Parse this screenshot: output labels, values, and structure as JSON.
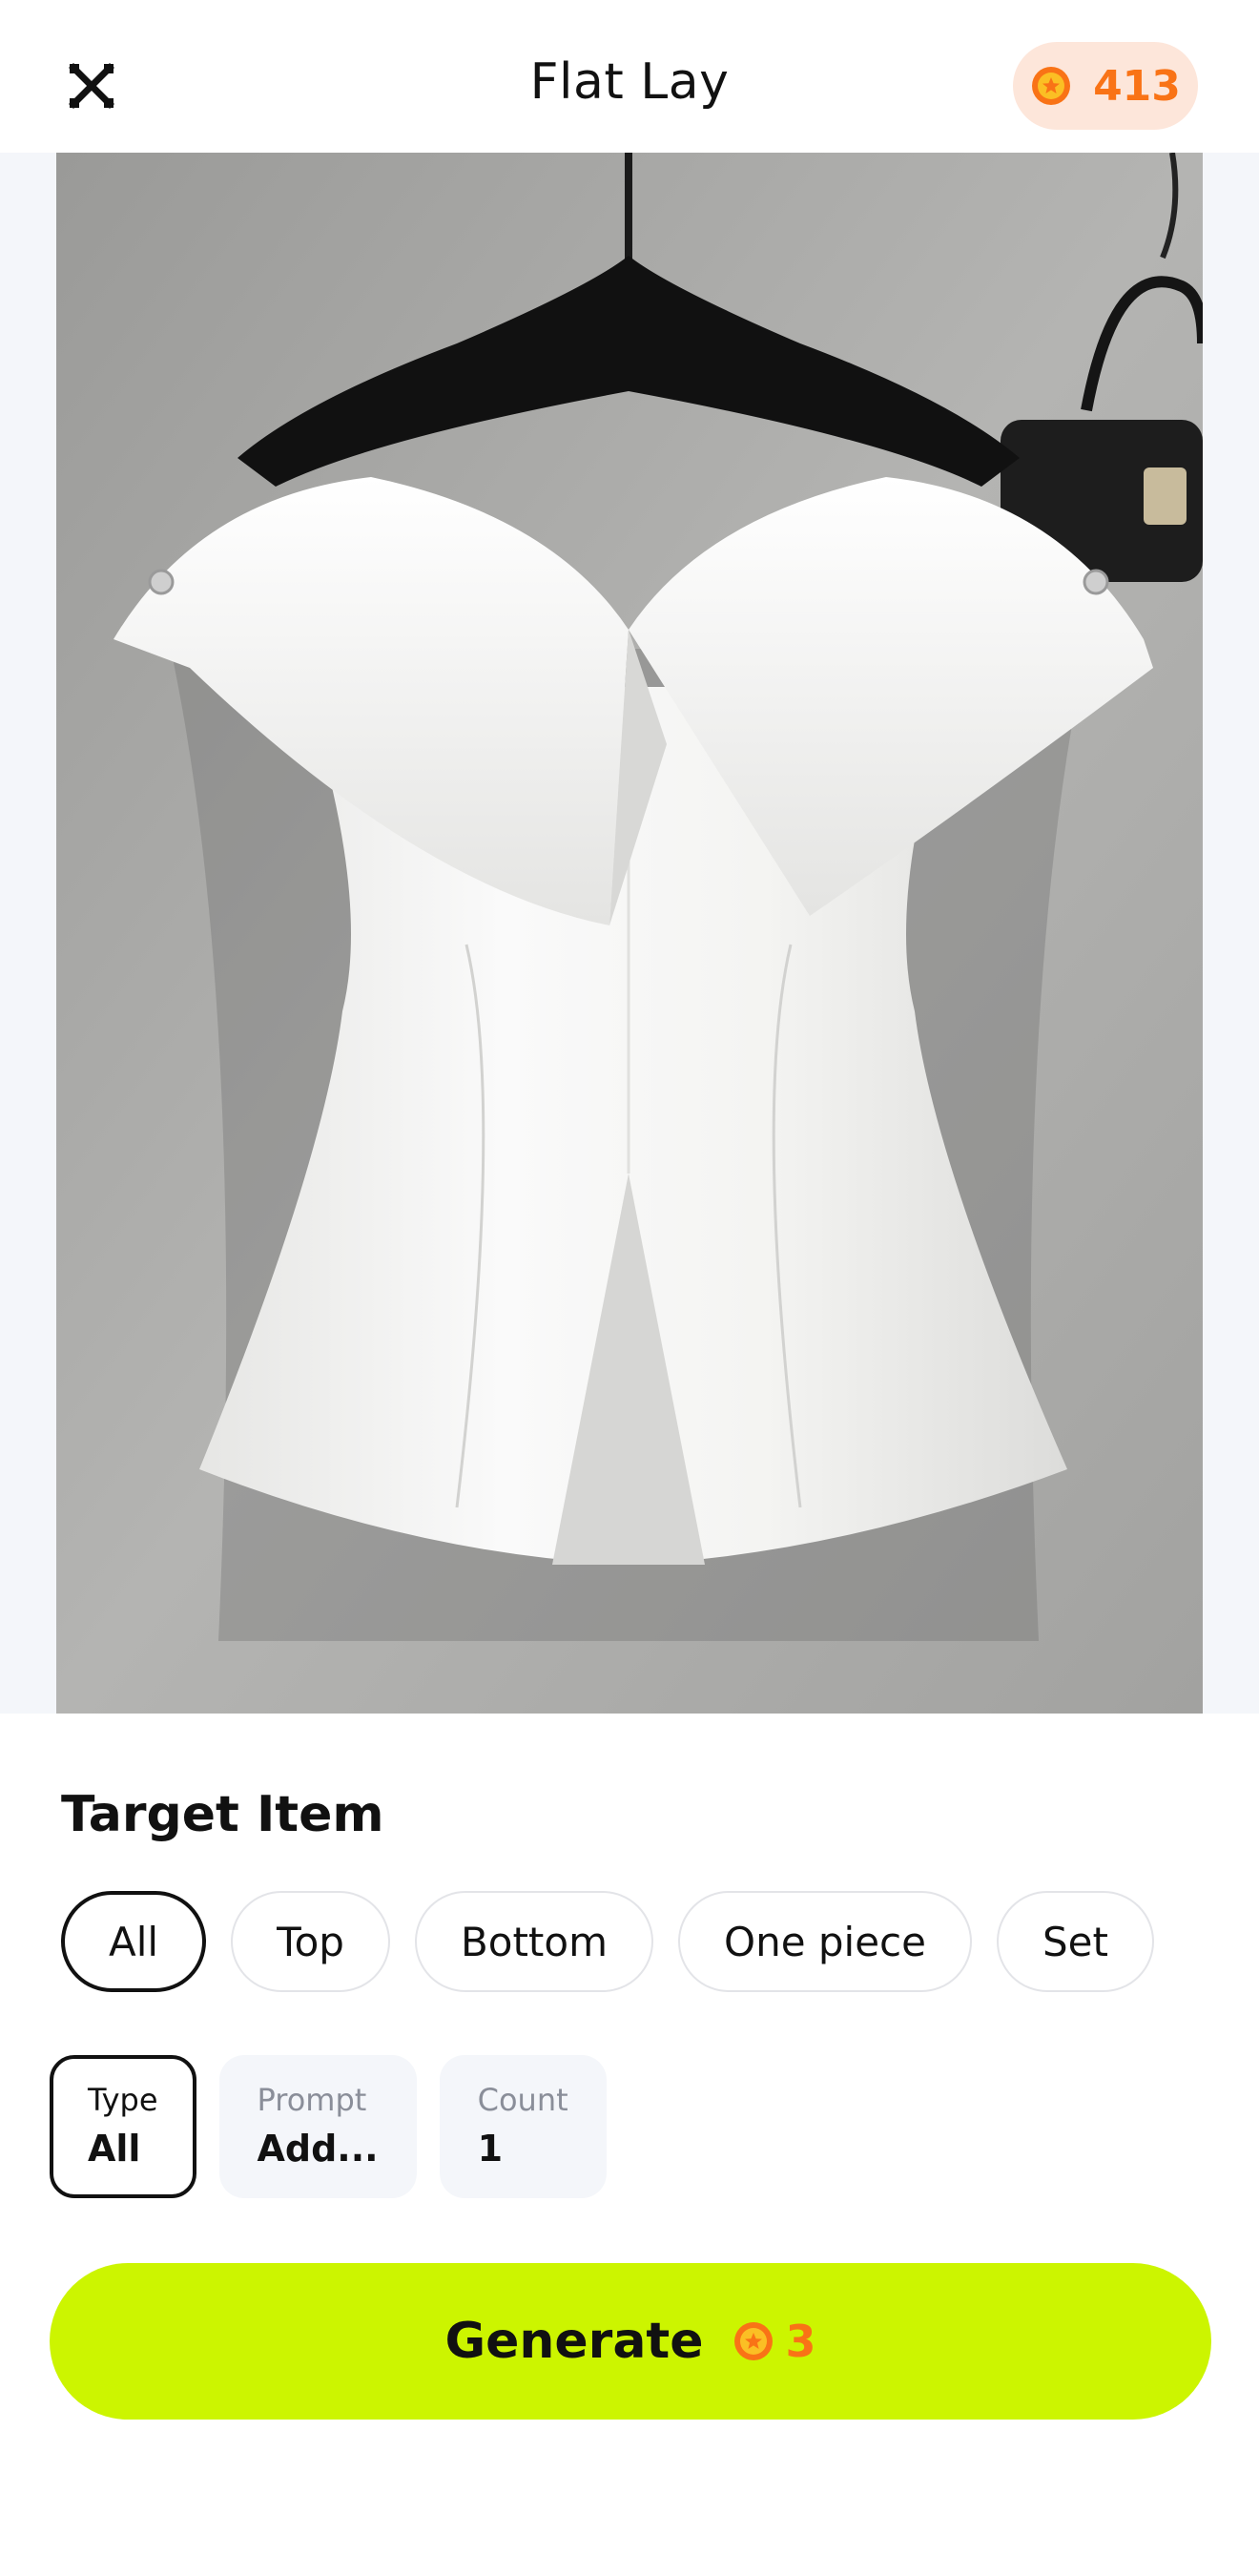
{
  "header": {
    "title": "Flat Lay",
    "credits": "413",
    "close_icon": "close-icon",
    "coin_icon": "coin-icon"
  },
  "colors": {
    "accent": "#ccf500",
    "coin": "#f97316",
    "credits_bg": "#fde6da"
  },
  "photo": {
    "icon": "white-off-shoulder-peplum-top-on-hanger"
  },
  "target": {
    "title": "Target Item",
    "options": [
      "All",
      "Top",
      "Bottom",
      "One piece",
      "Set"
    ],
    "selected": "All"
  },
  "params": {
    "type": {
      "label": "Type",
      "value": "All"
    },
    "prompt": {
      "label": "Prompt",
      "value": "Add..."
    },
    "count": {
      "label": "Count",
      "value": "1"
    }
  },
  "generate": {
    "label": "Generate",
    "cost": "3"
  }
}
